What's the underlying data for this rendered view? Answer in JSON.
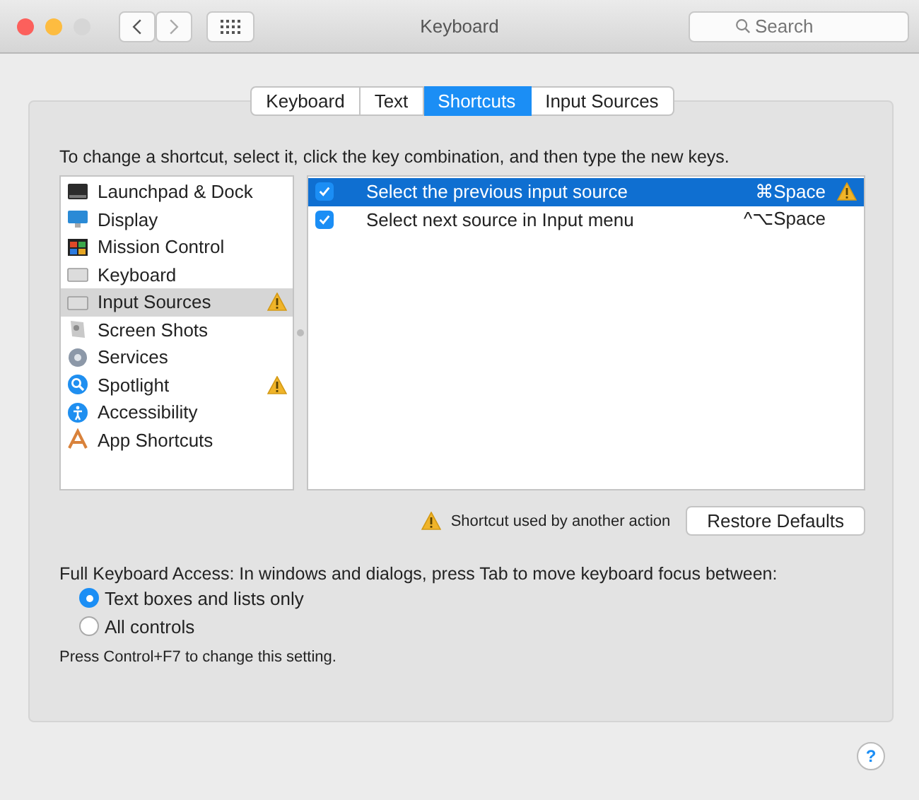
{
  "window": {
    "title": "Keyboard"
  },
  "search": {
    "placeholder": "Search"
  },
  "tabs": [
    {
      "label": "Keyboard",
      "selected": false
    },
    {
      "label": "Text",
      "selected": false
    },
    {
      "label": "Shortcuts",
      "selected": true
    },
    {
      "label": "Input Sources",
      "selected": false
    }
  ],
  "instruction": "To change a shortcut, select it, click the key combination, and then type the new keys.",
  "categories": [
    {
      "label": "Launchpad & Dock",
      "selected": false,
      "warning": false
    },
    {
      "label": "Display",
      "selected": false,
      "warning": false
    },
    {
      "label": "Mission Control",
      "selected": false,
      "warning": false
    },
    {
      "label": "Keyboard",
      "selected": false,
      "warning": false
    },
    {
      "label": "Input Sources",
      "selected": true,
      "warning": true
    },
    {
      "label": "Screen Shots",
      "selected": false,
      "warning": false
    },
    {
      "label": "Services",
      "selected": false,
      "warning": false
    },
    {
      "label": "Spotlight",
      "selected": false,
      "warning": true
    },
    {
      "label": "Accessibility",
      "selected": false,
      "warning": false
    },
    {
      "label": "App Shortcuts",
      "selected": false,
      "warning": false
    }
  ],
  "shortcuts": [
    {
      "label": "Select the previous input source",
      "keys": "⌘Space",
      "checked": true,
      "selected": true,
      "warning": true
    },
    {
      "label": "Select next source in Input menu",
      "keys": "^⌥Space",
      "checked": true,
      "selected": false,
      "warning": false
    }
  ],
  "conflict_note": "Shortcut used by another action",
  "restore_button": "Restore Defaults",
  "full_keyboard_access": "Full Keyboard Access: In windows and dialogs, press Tab to move keyboard focus between:",
  "access_options": [
    {
      "label": "Text boxes and lists only",
      "selected": true
    },
    {
      "label": "All controls",
      "selected": false
    }
  ],
  "hint": "Press Control+F7 to change this setting.",
  "help_button": "?"
}
